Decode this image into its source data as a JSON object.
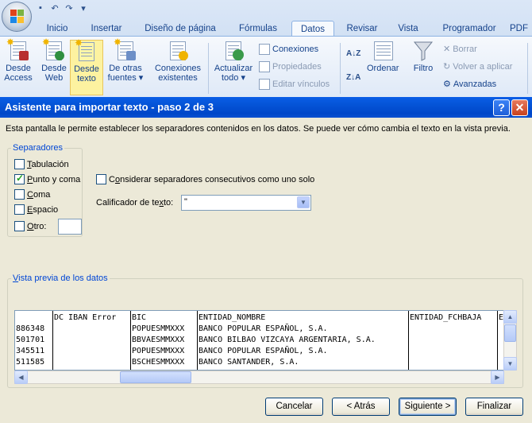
{
  "ribbon": {
    "tabs": [
      "Inicio",
      "Insertar",
      "Diseño de página",
      "Fórmulas",
      "Datos",
      "Revisar",
      "Vista",
      "Programador",
      "PDF"
    ],
    "active_tab": "Datos",
    "get_external": {
      "access": [
        "Desde",
        "Access"
      ],
      "web": [
        "Desde",
        "Web"
      ],
      "text": [
        "Desde",
        "texto"
      ],
      "other": [
        "De otras",
        "fuentes ▾"
      ],
      "existing": [
        "Conexiones",
        "existentes"
      ]
    },
    "connections": {
      "refresh": [
        "Actualizar",
        "todo ▾"
      ],
      "connections": "Conexiones",
      "properties": "Propiedades",
      "edit_links": "Editar vínculos"
    },
    "sort": {
      "sort": "Ordenar",
      "filter": "Filtro",
      "clear": "Borrar",
      "reapply": "Volver a aplicar",
      "advanced": "Avanzadas"
    }
  },
  "dialog": {
    "title": "Asistente para importar texto - paso 2 de 3",
    "help": "?",
    "close": "✕",
    "description": "Esta pantalla le permite establecer los separadores contenidos en los datos. Se puede ver cómo cambia el texto en la vista previa.",
    "separators": {
      "title": "Separadores",
      "tab": {
        "label_u": "T",
        "label_rest": "abulación",
        "checked": false
      },
      "semicolon": {
        "label_u": "P",
        "label_rest": "unto y coma",
        "checked": true
      },
      "comma": {
        "label_u": "C",
        "label_rest": "oma",
        "checked": false
      },
      "space": {
        "label_u": "E",
        "label_rest": "spacio",
        "checked": false
      },
      "other": {
        "label_u": "O",
        "label_rest": "tro:",
        "checked": false,
        "value": ""
      }
    },
    "consecutive": {
      "label_pre": "C",
      "label_u": "o",
      "label_rest": "nsiderar separadores consecutivos como uno solo",
      "checked": false
    },
    "qualifier": {
      "label_pre": "Calificador de te",
      "label_u": "x",
      "label_rest": "to:",
      "value": "\""
    },
    "preview": {
      "title_u": "V",
      "title_rest": "ista previa de los datos",
      "header": [
        "",
        "DC IBAN Error",
        "BIC",
        "ENTIDAD_NOMBRE",
        "ENTIDAD_FCHBAJA",
        "E"
      ],
      "rows": [
        [
          "886348",
          "",
          "POPUESMMXXX",
          "BANCO POPULAR ESPAÑOL, S.A.",
          "",
          ""
        ],
        [
          "501701",
          "",
          "BBVAESMMXXX",
          "BANCO BILBAO VIZCAYA ARGENTARIA, S.A.",
          "",
          ""
        ],
        [
          "345511",
          "",
          "POPUESMMXXX",
          "BANCO POPULAR ESPAÑOL, S.A.",
          "",
          ""
        ],
        [
          "511585",
          "",
          "BSCHESMMXXX",
          "BANCO SANTANDER, S.A.",
          "",
          ""
        ]
      ]
    },
    "buttons": {
      "cancel": "Cancelar",
      "back": "< Atrás",
      "next": "Siguiente >",
      "finish": "Finalizar"
    }
  }
}
